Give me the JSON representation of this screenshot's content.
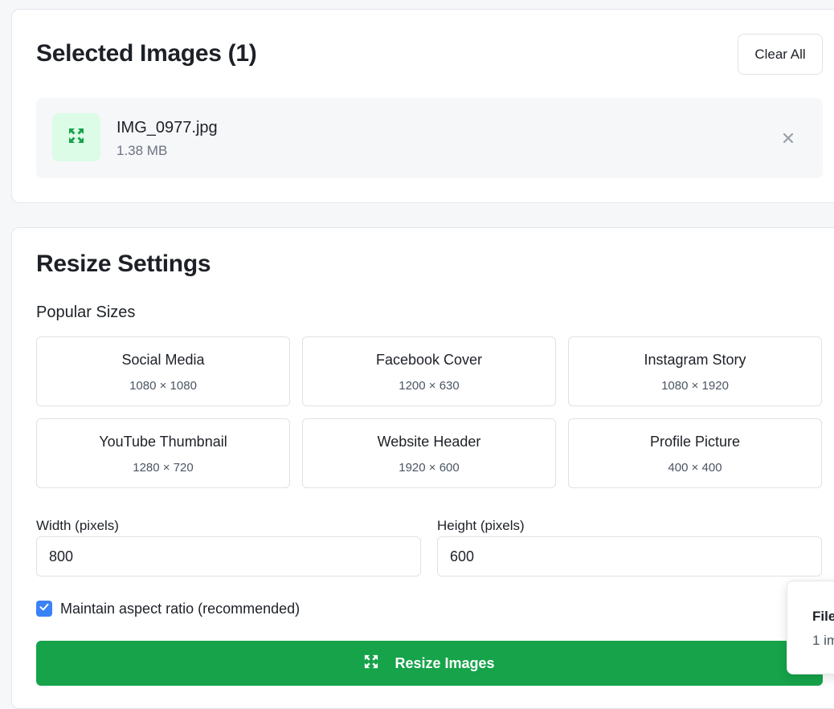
{
  "selected_images": {
    "title": "Selected Images (1)",
    "clear_all_label": "Clear All",
    "files": [
      {
        "name": "IMG_0977.jpg",
        "size": "1.38 MB",
        "icon": "expand-arrows-icon",
        "remove_icon": "close-icon"
      }
    ]
  },
  "resize_settings": {
    "title": "Resize Settings",
    "popular_sizes_label": "Popular Sizes",
    "presets": [
      {
        "name": "Social Media",
        "dims": "1080 × 1080"
      },
      {
        "name": "Facebook Cover",
        "dims": "1200 × 630"
      },
      {
        "name": "Instagram Story",
        "dims": "1080 × 1920"
      },
      {
        "name": "YouTube Thumbnail",
        "dims": "1280 × 720"
      },
      {
        "name": "Website Header",
        "dims": "1920 × 600"
      },
      {
        "name": "Profile Picture",
        "dims": "400 × 400"
      }
    ],
    "width_label": "Width (pixels)",
    "width_value": "800",
    "height_label": "Height (pixels)",
    "height_value": "600",
    "maintain_aspect_label": "Maintain aspect ratio (recommended)",
    "maintain_aspect_checked": true,
    "resize_button_label": "Resize Images",
    "resize_button_icon": "expand-arrows-icon"
  },
  "toast": {
    "title": "File",
    "body": "1 im"
  },
  "colors": {
    "accent_green": "#16a34a",
    "thumb_bg": "#dcfce7",
    "checkbox_blue": "#3b82f6"
  }
}
